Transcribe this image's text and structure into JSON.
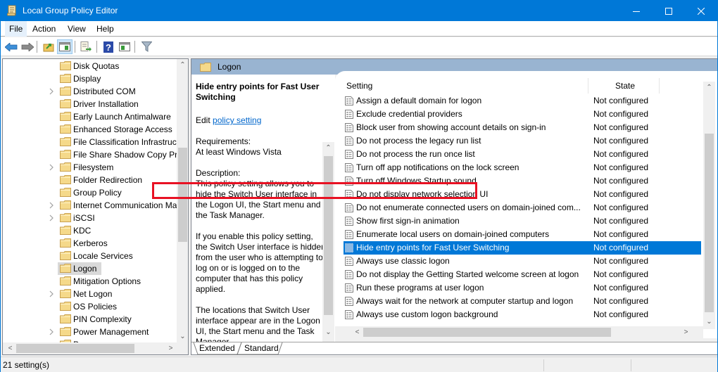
{
  "window": {
    "title": "Local Group Policy Editor",
    "controls": {
      "minimize": "minimize",
      "maximize": "maximize",
      "close": "close"
    }
  },
  "menu": [
    "File",
    "Action",
    "View",
    "Help"
  ],
  "toolbar": {
    "buttons": [
      "back-icon",
      "forward-icon",
      "up-folder-icon",
      "show-hide-console-tree-icon",
      "export-list-icon",
      "help-icon",
      "show-hide-action-pane-icon",
      "filter-icon"
    ]
  },
  "tree": {
    "items": [
      {
        "label": "Disk Quotas",
        "expandable": false
      },
      {
        "label": "Display",
        "expandable": false
      },
      {
        "label": "Distributed COM",
        "expandable": true
      },
      {
        "label": "Driver Installation",
        "expandable": false
      },
      {
        "label": "Early Launch Antimalware",
        "expandable": false
      },
      {
        "label": "Enhanced Storage Access",
        "expandable": false
      },
      {
        "label": "File Classification Infrastructure",
        "expandable": false
      },
      {
        "label": "File Share Shadow Copy Provider",
        "expandable": false
      },
      {
        "label": "Filesystem",
        "expandable": true
      },
      {
        "label": "Folder Redirection",
        "expandable": false
      },
      {
        "label": "Group Policy",
        "expandable": false
      },
      {
        "label": "Internet Communication Management",
        "expandable": true
      },
      {
        "label": "iSCSI",
        "expandable": true
      },
      {
        "label": "KDC",
        "expandable": false
      },
      {
        "label": "Kerberos",
        "expandable": false
      },
      {
        "label": "Locale Services",
        "expandable": false
      },
      {
        "label": "Logon",
        "expandable": false,
        "selected": true
      },
      {
        "label": "Mitigation Options",
        "expandable": false
      },
      {
        "label": "Net Logon",
        "expandable": true
      },
      {
        "label": "OS Policies",
        "expandable": false
      },
      {
        "label": "PIN Complexity",
        "expandable": false
      },
      {
        "label": "Power Management",
        "expandable": true
      },
      {
        "label": "P...",
        "expandable": false
      }
    ]
  },
  "right_pane": {
    "header": "Logon",
    "description": {
      "title": "Hide entry points for Fast User Switching",
      "edit_prefix": "Edit ",
      "edit_link": "policy setting ",
      "requirements_label": "Requirements:",
      "requirements_value": "At least Windows Vista",
      "description_label": "Description:",
      "paragraph1": "This policy setting allows you to hide the Switch User interface in the Logon UI, the Start menu and the Task Manager.",
      "paragraph2": "If you enable this policy setting, the Switch User interface is hidden from the user who is attempting to log on or is logged on to the computer that has this policy applied.",
      "paragraph3": "The locations that Switch User interface appear are in the Logon UI, the Start menu and the Task Manager."
    },
    "list": {
      "columns": {
        "setting": "Setting",
        "state": "State"
      },
      "rows": [
        {
          "name": "Assign a default domain for logon",
          "state": "Not configured"
        },
        {
          "name": "Exclude credential providers",
          "state": "Not configured"
        },
        {
          "name": "Block user from showing account details on sign-in",
          "state": "Not configured"
        },
        {
          "name": "Do not process the legacy run list",
          "state": "Not configured"
        },
        {
          "name": "Do not process the run once list",
          "state": "Not configured"
        },
        {
          "name": "Turn off app notifications on the lock screen",
          "state": "Not configured"
        },
        {
          "name": "Turn off Windows Startup sound",
          "state": "Not configured"
        },
        {
          "name": "Do not display network selection UI",
          "state": "Not configured"
        },
        {
          "name": "Do not enumerate connected users on domain-joined com...",
          "state": "Not configured"
        },
        {
          "name": "Show first sign-in animation",
          "state": "Not configured"
        },
        {
          "name": "Enumerate local users on domain-joined computers",
          "state": "Not configured"
        },
        {
          "name": "Hide entry points for Fast User Switching",
          "state": "Not configured",
          "selected": true
        },
        {
          "name": "Always use classic logon",
          "state": "Not configured"
        },
        {
          "name": "Do not display the Getting Started welcome screen at logon",
          "state": "Not configured"
        },
        {
          "name": "Run these programs at user logon",
          "state": "Not configured"
        },
        {
          "name": "Always wait for the network at computer startup and logon",
          "state": "Not configured"
        },
        {
          "name": "Always use custom logon background",
          "state": "Not configured"
        }
      ]
    },
    "tabs": [
      "Extended",
      "Standard"
    ],
    "active_tab": "Extended"
  },
  "status_bar": {
    "text": "21 setting(s)"
  },
  "colors": {
    "accent": "#0078d7",
    "selection": "#0078d7",
    "highlight_box": "#e81123",
    "pane_header": "#99b4d1"
  }
}
